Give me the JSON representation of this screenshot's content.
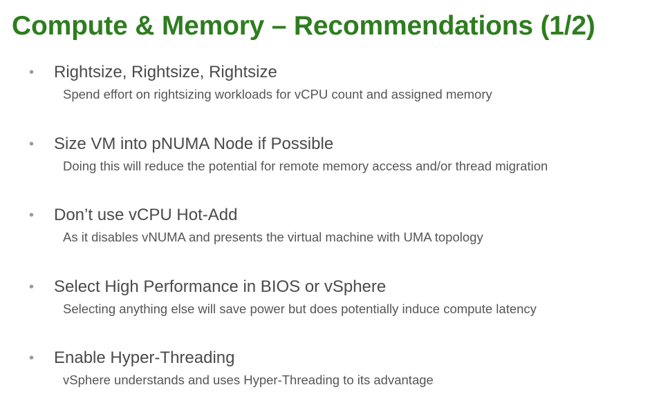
{
  "slide": {
    "title": "Compute & Memory – Recommendations (1/2)",
    "bullet_glyph": "•",
    "colors": {
      "title": "#2e7d1f",
      "heading": "#4a4a4a",
      "subtext": "#555555",
      "bullet": "#9a9a9a"
    },
    "bullets": [
      {
        "heading": "Rightsize, Rightsize, Rightsize",
        "sub": "Spend effort on rightsizing workloads for vCPU count and assigned memory"
      },
      {
        "heading": "Size VM into pNUMA Node if Possible",
        "sub": "Doing this will reduce the potential for remote memory access and/or thread migration"
      },
      {
        "heading": "Don’t use vCPU Hot-Add",
        "sub": "As it disables vNUMA and presents the virtual machine with UMA topology"
      },
      {
        "heading": "Select High Performance in BIOS or vSphere",
        "sub": "Selecting anything else will save power but does potentially induce compute latency"
      },
      {
        "heading": "Enable Hyper-Threading",
        "sub": "vSphere understands and uses Hyper-Threading to its advantage"
      }
    ]
  }
}
